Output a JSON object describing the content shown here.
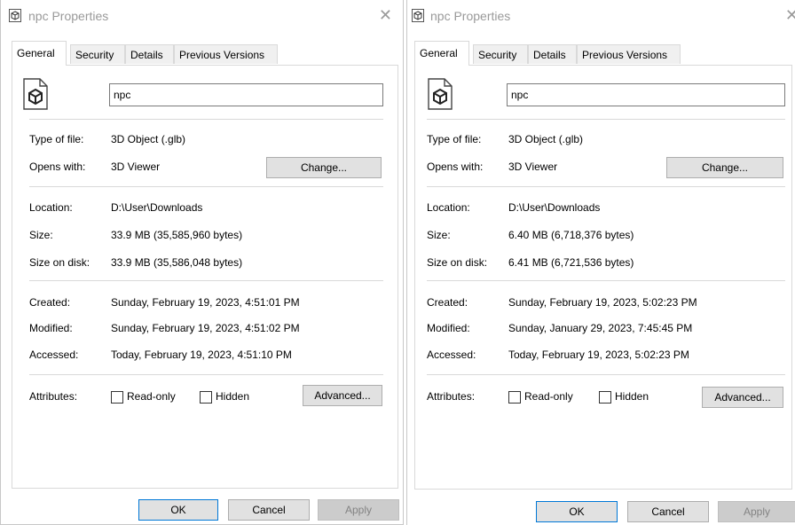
{
  "dialogs": [
    {
      "title": "npc Properties",
      "tabs": [
        "General",
        "Security",
        "Details",
        "Previous Versions"
      ],
      "file_name": "npc",
      "type_of_file_label": "Type of file:",
      "type_of_file": "3D Object (.glb)",
      "opens_with_label": "Opens with:",
      "opens_with": "3D Viewer",
      "change_label": "Change...",
      "location_label": "Location:",
      "location": "D:\\User\\Downloads",
      "size_label": "Size:",
      "size": "33.9 MB (35,585,960 bytes)",
      "size_on_disk_label": "Size on disk:",
      "size_on_disk": "33.9 MB (35,586,048 bytes)",
      "created_label": "Created:",
      "created": "Sunday, February 19, 2023, 4:51:01 PM",
      "modified_label": "Modified:",
      "modified": "Sunday, February 19, 2023, 4:51:02 PM",
      "accessed_label": "Accessed:",
      "accessed": "Today, February 19, 2023, 4:51:10 PM",
      "attributes_label": "Attributes:",
      "readonly_label": "Read-only",
      "hidden_label": "Hidden",
      "advanced_label": "Advanced...",
      "ok_label": "OK",
      "cancel_label": "Cancel",
      "apply_label": "Apply"
    },
    {
      "title": "npc Properties",
      "tabs": [
        "General",
        "Security",
        "Details",
        "Previous Versions"
      ],
      "file_name": "npc",
      "type_of_file_label": "Type of file:",
      "type_of_file": "3D Object (.glb)",
      "opens_with_label": "Opens with:",
      "opens_with": "3D Viewer",
      "change_label": "Change...",
      "location_label": "Location:",
      "location": "D:\\User\\Downloads",
      "size_label": "Size:",
      "size": "6.40 MB (6,718,376 bytes)",
      "size_on_disk_label": "Size on disk:",
      "size_on_disk": "6.41 MB (6,721,536 bytes)",
      "created_label": "Created:",
      "created": "Sunday, February 19, 2023, 5:02:23 PM",
      "modified_label": "Modified:",
      "modified": "Sunday, January 29, 2023, 7:45:45 PM",
      "accessed_label": "Accessed:",
      "accessed": "Today, February 19, 2023, 5:02:23 PM",
      "attributes_label": "Attributes:",
      "readonly_label": "Read-only",
      "hidden_label": "Hidden",
      "advanced_label": "Advanced...",
      "ok_label": "OK",
      "cancel_label": "Cancel",
      "apply_label": "Apply"
    }
  ],
  "icons": {
    "title_icon": "3d-object-icon",
    "file_icon": "3d-object-file-icon",
    "close_icon": "close-icon"
  }
}
